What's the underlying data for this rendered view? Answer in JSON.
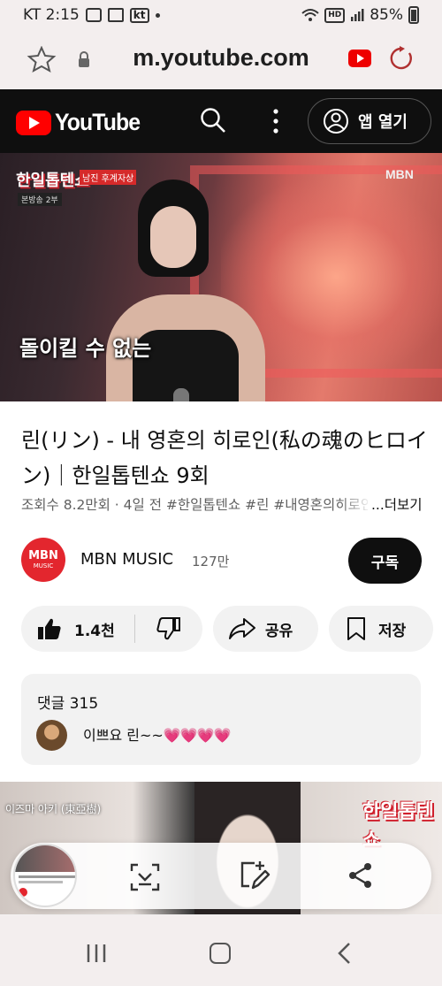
{
  "status_bar": {
    "carrier_time": "KT 2:15",
    "carrier_badge": "kt",
    "network_badge": "HD",
    "battery": "85%"
  },
  "browser": {
    "url": "m.youtube.com"
  },
  "youtube_header": {
    "logo_text": "YouTube",
    "open_app_label": "앱 열기"
  },
  "video": {
    "show_logo": "한일톱텐쇼",
    "show_tag": "남진 후계자상",
    "show_sub": "본방송 2부",
    "broadcaster_watermark": "MBN",
    "subtitle": "돌이킬 수 없는"
  },
  "details": {
    "title": "린(リン) - 내 영혼의 히로인(私の魂のヒロイン)｜한일톱텐쇼 9회",
    "meta": "조회수 8.2만회 · 4일 전  #한일톱텐쇼 #린 #내영혼의히로인",
    "more_label": "...더보기"
  },
  "channel": {
    "avatar_text_top": "MBN",
    "avatar_text_bottom": "MUSIC",
    "name": "MBN MUSIC",
    "subscribers": "127만",
    "subscribe_label": "구독"
  },
  "actions": {
    "like_count": "1.4천",
    "share_label": "공유",
    "save_label": "저장"
  },
  "comments": {
    "header": "댓글 315",
    "top_comment_text": "이쁘요 린~~",
    "top_comment_emoji": "💗💗💗💗"
  },
  "next_video": {
    "label": "이즈마 아키 (東亞樹)",
    "logo": "한일톱텐쇼"
  },
  "colors": {
    "youtube_red": "#ff0000",
    "header_bg": "#0f0f0f",
    "pill_bg": "#f2f2f2",
    "mbn_red": "#e3262e"
  },
  "icons": [
    "star-icon",
    "lock-icon",
    "youtube-icon",
    "reload-icon",
    "search-icon",
    "more-vert-icon",
    "account-icon",
    "thumbs-up-icon",
    "thumbs-down-icon",
    "share-icon",
    "bookmark-icon",
    "scan-icon",
    "edit-icon",
    "share-network-icon",
    "recent-apps-icon",
    "home-icon",
    "back-icon"
  ]
}
